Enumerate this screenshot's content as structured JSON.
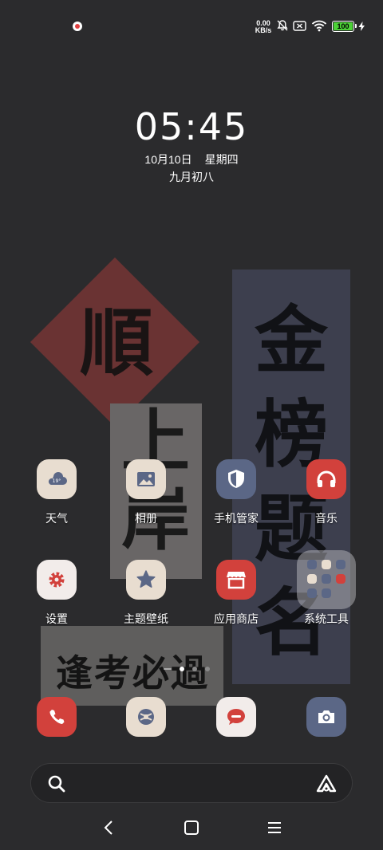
{
  "status_bar": {
    "net_speed_value": "0.00",
    "net_speed_unit": "KB/s",
    "battery_level": "100",
    "icons": [
      "recording-dot-icon",
      "mute-icon",
      "sim-off-icon",
      "wifi-icon",
      "battery-icon",
      "charging-icon"
    ]
  },
  "clock": {
    "time": "05:45",
    "date": "10月10日",
    "weekday": "星期四",
    "lunar": "九月初八"
  },
  "wallpaper": {
    "shun": "順",
    "grey_panel": "上岸",
    "navy_panel": "金榜题名",
    "band": "逢考必過"
  },
  "apps_row1": [
    {
      "label": "天气",
      "icon": "weather-icon"
    },
    {
      "label": "相册",
      "icon": "gallery-icon"
    },
    {
      "label": "手机管家",
      "icon": "security-shield-icon"
    },
    {
      "label": "音乐",
      "icon": "headphones-icon"
    }
  ],
  "apps_row2": [
    {
      "label": "设置",
      "icon": "settings-gear-icon"
    },
    {
      "label": "主题壁纸",
      "icon": "theme-star-icon"
    },
    {
      "label": "应用商店",
      "icon": "app-store-icon"
    },
    {
      "label": "系统工具",
      "icon": "folder-icon"
    }
  ],
  "dock": [
    {
      "icon": "phone-icon"
    },
    {
      "icon": "browser-icon"
    },
    {
      "icon": "messages-icon"
    },
    {
      "icon": "camera-icon"
    }
  ],
  "pager": {
    "pages": 4,
    "current_page": 2
  },
  "colors": {
    "background": "#2b2b2d",
    "icon_cream": "#e8ddd0",
    "icon_red": "#d2413c",
    "icon_slate": "#5b6786",
    "battery_green": "#4cd137"
  }
}
